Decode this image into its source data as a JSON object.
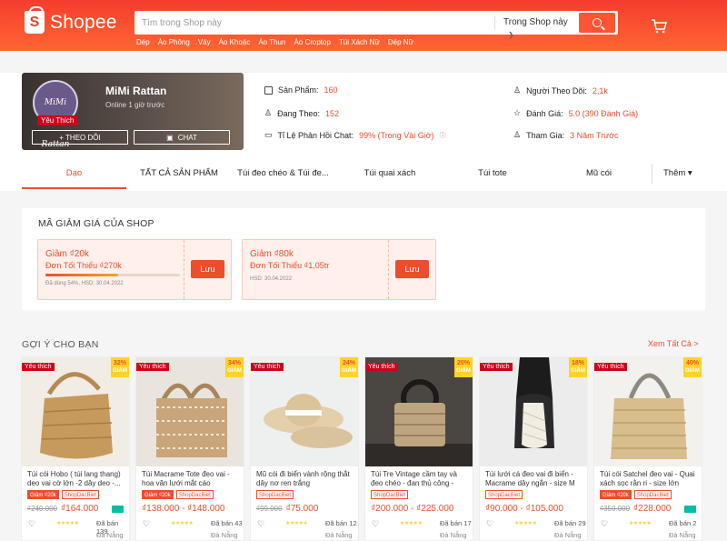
{
  "header": {
    "logo_text": "Shopee",
    "search_placeholder": "Tìm trong Shop này",
    "search_scope": "Trong Shop này",
    "keywords": [
      "Dép",
      "Áo Phông",
      "Váy",
      "Áo Khoác",
      "Áo Thun",
      "Áo Croptop",
      "Túi Xách Nữ",
      "Dép Nữ"
    ]
  },
  "shop": {
    "avatar_text": "MiMi Rattan",
    "badge": "Yêu Thích",
    "name": "MiMi Rattan",
    "online": "Online 1 giờ trước",
    "follow_label": "+ THEO DÕI",
    "chat_label": "CHAT",
    "stats": {
      "products_label": "Sản Phẩm:",
      "products_val": "160",
      "following_label": "Đang Theo:",
      "following_val": "152",
      "chat_label": "Tỉ Lệ Phản Hồi Chat:",
      "chat_val": "99% (Trong Vài Giờ)",
      "followers_label": "Người Theo Dõi:",
      "followers_val": "2,1k",
      "rating_label": "Đánh Giá:",
      "rating_val": "5.0 (390 Đánh Giá)",
      "joined_label": "Tham Gia:",
      "joined_val": "3 Năm Trước"
    }
  },
  "tabs": [
    "Dạo",
    "TẤT CẢ SẢN PHẨM",
    "Túi đeo chéo & Túi đe...",
    "Túi quai xách",
    "Túi tote",
    "Mũ cói"
  ],
  "tab_more": "Thêm ▾",
  "vouchers": {
    "title": "MÃ GIẢM GIÁ CỦA SHOP",
    "items": [
      {
        "amount": "Giảm ₫20k",
        "min": "Đơn Tối Thiểu ₫270k",
        "progress": 0.54,
        "note": "Đã dùng 54%, HSD: 30.04.2022",
        "save": "Lưu"
      },
      {
        "amount": "Giảm ₫80k",
        "min": "Đơn Tối Thiểu ₫1,05tr",
        "progress": 0,
        "note": "HSD: 30.04.2022",
        "save": "Lưu"
      }
    ]
  },
  "recommend": {
    "title": "GỢI Ý CHO BẠN",
    "see_all": "Xem Tất Cả >",
    "products": [
      {
        "badge": "Yêu thích",
        "disc": "32%",
        "disc_label": "GIẢM",
        "name": "Túi cói Hobo ( túi lang thang) deo vai cờ lớn -2 dây deo -...",
        "tags": [
          "Giảm ₫20k",
          "ShopDacBiet"
        ],
        "old": "₫240.000",
        "new": "₫164.000",
        "sold": "Đã bán 139",
        "loc": "Đà Nẵng",
        "truck": true
      },
      {
        "badge": "Yêu thích",
        "disc": "34%",
        "disc_label": "GIẢM",
        "name": "Túi Macrame Tote đeo vai - hoa văn lưới mắt cáo",
        "tags": [
          "Giảm ₫20k",
          "ShopDacBiet"
        ],
        "old": "",
        "new": "₫138.000 - ₫148.000",
        "sold": "Đã bán 43",
        "loc": "Đà Nẵng",
        "truck": false
      },
      {
        "badge": "Yêu thích",
        "disc": "24%",
        "disc_label": "GIẢM",
        "name": "Mũ cói đi biển vành rộng thắt dây nơ ren trắng",
        "tags": [
          "ShopDacBiet"
        ],
        "old": "₫99.000",
        "new": "₫75.000",
        "sold": "Đã bán 12",
        "loc": "Đà Nẵng",
        "truck": false
      },
      {
        "badge": "Yêu thích",
        "disc": "20%",
        "disc_label": "GIẢM",
        "name": "Túi Tre Vintage cầm tay và đeo chéo - đan thủ công - nhiều...",
        "tags": [
          "ShopDacBiet"
        ],
        "old": "",
        "new": "₫200.000 - ₫225.000",
        "sold": "Đã bán 17",
        "loc": "Đà Nẵng",
        "truck": false
      },
      {
        "badge": "Yêu thích",
        "disc": "18%",
        "disc_label": "GIẢM",
        "name": "Túi lưới cá đeo vai đi biển - Macrame dây ngắn - size M",
        "tags": [
          "ShopDacBiet"
        ],
        "old": "",
        "new": "₫90.000 - ₫105.000",
        "sold": "Đã bán 29",
        "loc": "Đà Nẵng",
        "truck": false
      },
      {
        "badge": "Yêu thích",
        "disc": "40%",
        "disc_label": "GIẢM",
        "name": "Túi cói Satchel đeo vai - Quai xách sọc rằn ri - size lớn",
        "tags": [
          "Giảm ₫20k",
          "ShopDacBiet"
        ],
        "old": "₫350.000",
        "new": "₫228.000",
        "sold": "Đã bán 2",
        "loc": "Đà Nẵng",
        "truck": true
      }
    ]
  },
  "colors": {
    "brand": "#ee4d2d",
    "header_top": "#f53d2d",
    "header_bottom": "#ff6633",
    "free_ship": "#00bfa5"
  }
}
